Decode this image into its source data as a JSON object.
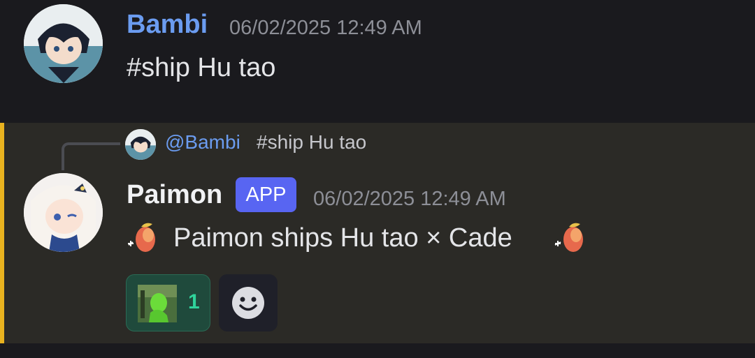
{
  "messages": [
    {
      "author": "Bambi",
      "timestamp": "06/02/2025 12:49 AM",
      "text": "#ship Hu tao"
    },
    {
      "reply": {
        "mention": "@Bambi",
        "text": "#ship Hu tao"
      },
      "author": "Paimon",
      "badge": "APP",
      "timestamp": "06/02/2025 12:49 AM",
      "text": "Paimon ships Hu tao × Cade",
      "reactions": [
        {
          "count": "1"
        }
      ]
    }
  ],
  "colors": {
    "accent_bar": "#e8b21f",
    "mention": "#6b9cf0",
    "app_badge": "#5865f2",
    "reaction_bg": "#1f4a3c",
    "reaction_count": "#2fd39b"
  },
  "icons": [
    "peach-emoji-icon",
    "add-reaction-icon",
    "reaction-emoji-icon"
  ]
}
